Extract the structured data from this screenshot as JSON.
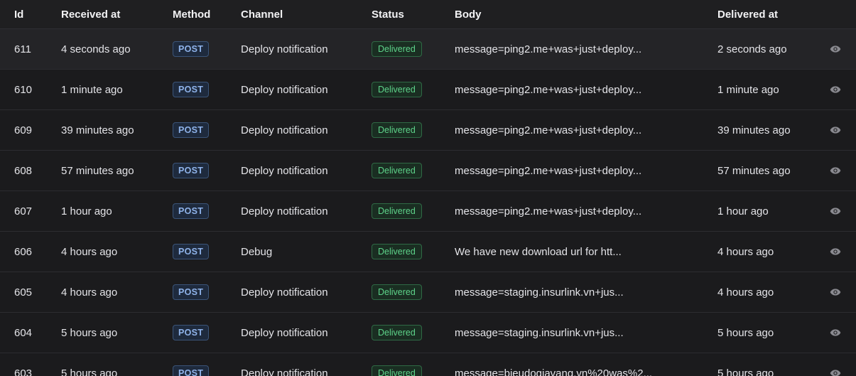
{
  "columns": {
    "id": "Id",
    "received_at": "Received at",
    "method": "Method",
    "channel": "Channel",
    "status": "Status",
    "body": "Body",
    "delivered_at": "Delivered at"
  },
  "colors": {
    "background": "#1b1b1d",
    "row_highlight": "#242427",
    "method_badge_text": "#8fb3ea",
    "status_badge_text": "#5ed38a",
    "icon": "#8a8a90"
  },
  "rows": [
    {
      "id": "611",
      "received_at": "4 seconds ago",
      "method": "POST",
      "channel": "Deploy notification",
      "status": "Delivered",
      "body": "message=ping2.me+was+just+deploy...",
      "delivered_at": "2 seconds ago",
      "action_icon": "eye-icon"
    },
    {
      "id": "610",
      "received_at": "1 minute ago",
      "method": "POST",
      "channel": "Deploy notification",
      "status": "Delivered",
      "body": "message=ping2.me+was+just+deploy...",
      "delivered_at": "1 minute ago",
      "action_icon": "eye-icon"
    },
    {
      "id": "609",
      "received_at": "39 minutes ago",
      "method": "POST",
      "channel": "Deploy notification",
      "status": "Delivered",
      "body": "message=ping2.me+was+just+deploy...",
      "delivered_at": "39 minutes ago",
      "action_icon": "eye-icon"
    },
    {
      "id": "608",
      "received_at": "57 minutes ago",
      "method": "POST",
      "channel": "Deploy notification",
      "status": "Delivered",
      "body": "message=ping2.me+was+just+deploy...",
      "delivered_at": "57 minutes ago",
      "action_icon": "eye-icon"
    },
    {
      "id": "607",
      "received_at": "1 hour ago",
      "method": "POST",
      "channel": "Deploy notification",
      "status": "Delivered",
      "body": "message=ping2.me+was+just+deploy...",
      "delivered_at": "1 hour ago",
      "action_icon": "eye-icon"
    },
    {
      "id": "606",
      "received_at": "4 hours ago",
      "method": "POST",
      "channel": "Debug",
      "status": "Delivered",
      "body": "We have new download url for htt...",
      "delivered_at": "4 hours ago",
      "action_icon": "eye-icon"
    },
    {
      "id": "605",
      "received_at": "4 hours ago",
      "method": "POST",
      "channel": "Deploy notification",
      "status": "Delivered",
      "body": "message=staging.insurlink.vn+jus...",
      "delivered_at": "4 hours ago",
      "action_icon": "eye-icon"
    },
    {
      "id": "604",
      "received_at": "5 hours ago",
      "method": "POST",
      "channel": "Deploy notification",
      "status": "Delivered",
      "body": "message=staging.insurlink.vn+jus...",
      "delivered_at": "5 hours ago",
      "action_icon": "eye-icon"
    },
    {
      "id": "603",
      "received_at": "5 hours ago",
      "method": "POST",
      "channel": "Deploy notification",
      "status": "Delivered",
      "body": "message=bieudogiavang.vn%20was%2...",
      "delivered_at": "5 hours ago",
      "action_icon": "eye-icon"
    }
  ]
}
